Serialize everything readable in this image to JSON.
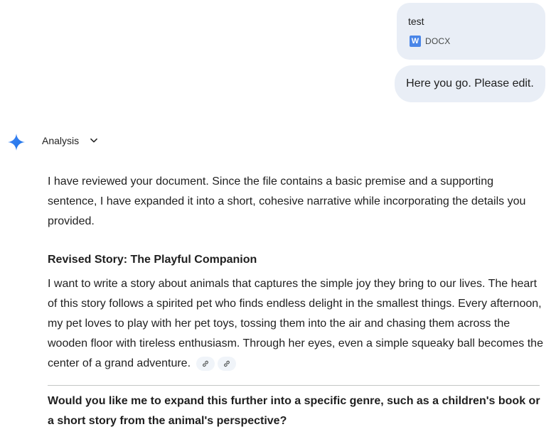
{
  "attachment": {
    "file_name": "test",
    "file_type": "DOCX",
    "icon_letter": "W",
    "icon_color": "#4a86e8"
  },
  "user_message": "Here you go. Please edit.",
  "response": {
    "toggle_label": "Analysis",
    "intro": "I have reviewed your document. Since the file contains a basic premise and a supporting sentence, I have expanded it into a short, cohesive narrative while incorporating the details you provided.",
    "story_title": "Revised Story: The Playful Companion",
    "story_body": "I want to write a story about animals that captures the simple joy they bring to our lives. The heart of this story follows a spirited pet who finds endless delight in the smallest things. Every afternoon, my pet loves to play with her pet toys, tossing them into the air and chasing them across the wooden floor with tireless enthusiasm. Through her eyes, even a simple squeaky ball becomes the center of a grand adventure.",
    "source_chips": [
      "link-icon",
      "link-icon"
    ],
    "follow_up": "Would you like me to expand this further into a specific genre, such as a children's book or a short story from the animal's perspective?"
  },
  "colors": {
    "bubble_bg": "#e9eef6",
    "gemini_blue": "#1a73e8",
    "chip_bg": "#f0f4f9"
  }
}
